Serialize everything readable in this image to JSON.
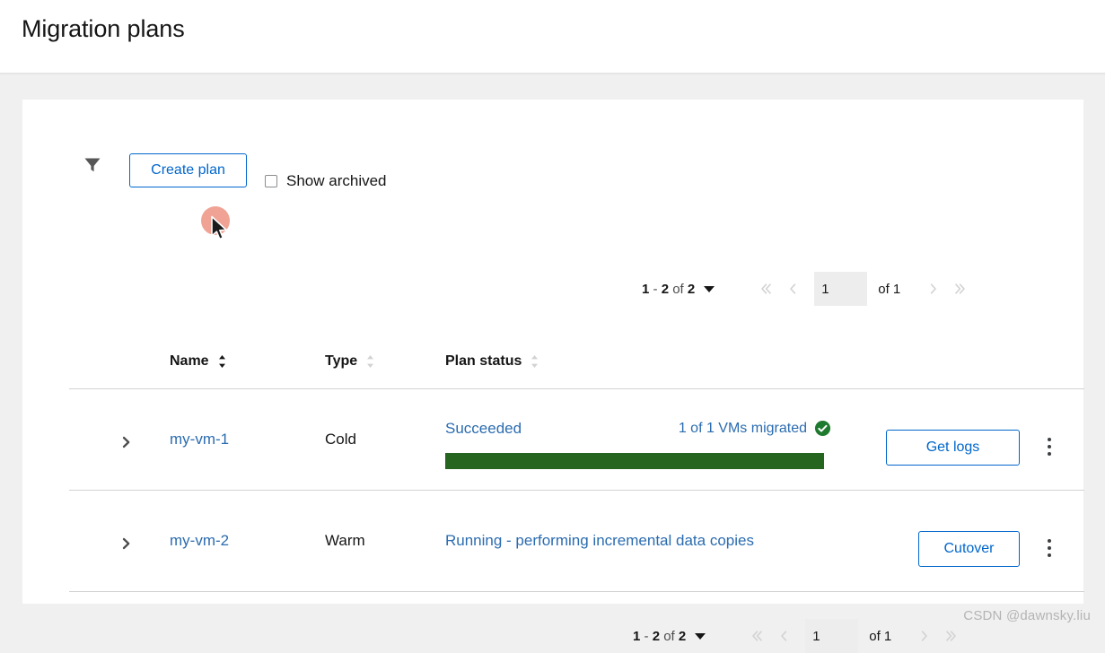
{
  "header": {
    "title": "Migration plans"
  },
  "toolbar": {
    "filter_icon": "filter-funnel-icon",
    "create_plan_label": "Create plan",
    "show_archived_label": "Show archived",
    "show_archived_checked": false
  },
  "pagination_top": {
    "range_start": "1",
    "range_dash": " - ",
    "range_end": "2",
    "of_word": " of ",
    "total": "2",
    "summary": "1 - 2 of 2",
    "page_value": "1",
    "page_of": "of 1",
    "first_icon": "chevron-double-left-icon",
    "prev_icon": "chevron-left-icon",
    "next_icon": "chevron-right-icon",
    "last_icon": "chevron-double-right-icon"
  },
  "pagination_bottom": {
    "summary": "1 - 2 of 2",
    "page_value": "1",
    "page_of": "of 1",
    "first_icon": "chevron-double-left-icon",
    "prev_icon": "chevron-left-icon",
    "next_icon": "chevron-right-icon",
    "last_icon": "chevron-double-right-icon"
  },
  "table": {
    "columns": [
      {
        "label": "Name",
        "sort_state": "active"
      },
      {
        "label": "Type",
        "sort_state": "inactive"
      },
      {
        "label": "Plan status",
        "sort_state": "inactive"
      }
    ],
    "rows": [
      {
        "expand_icon": "chevron-right-icon",
        "name": "my-vm-1",
        "type": "Cold",
        "status_text": "Succeeded",
        "status_count": "1 of 1 VMs migrated",
        "status_icon": "check-circle-icon",
        "progress_percent": 100,
        "action_label": "Get logs",
        "menu_icon": "kebab-menu-icon"
      },
      {
        "expand_icon": "chevron-right-icon",
        "name": "my-vm-2",
        "type": "Warm",
        "status_text": "Running - performing incremental data copies",
        "status_count": "",
        "status_icon": "",
        "progress_percent": null,
        "action_label": "Cutover",
        "menu_icon": "kebab-menu-icon"
      }
    ]
  },
  "colors": {
    "link": "#2b6cb0",
    "button_accent": "#0066cc",
    "progress_green": "#25651f",
    "success_green": "#1e7a2e",
    "page_background": "#f0f0f0",
    "card_background": "#ffffff",
    "cursor_highlight": "#f0a394"
  },
  "watermark": {
    "text": "CSDN @dawnsky.liu"
  }
}
